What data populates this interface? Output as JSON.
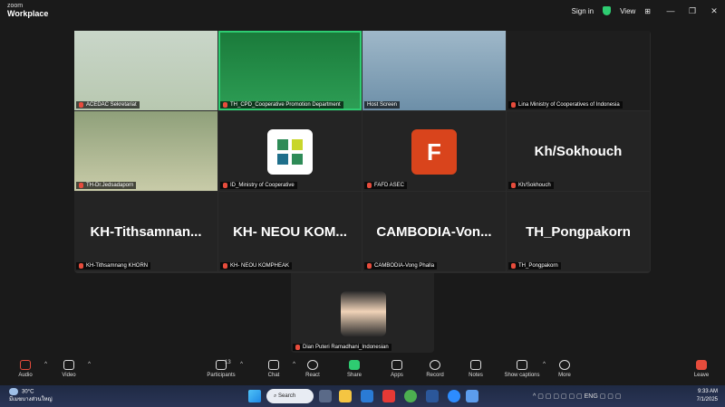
{
  "app": {
    "brand_line1": "zoom",
    "brand_line2": "Workplace"
  },
  "titlebar": {
    "sign_in": "Sign in",
    "view": "View"
  },
  "tiles": [
    {
      "name": "ACEDAC Sekretariat"
    },
    {
      "name": "TH_CPD_Cooperative Promotion Department"
    },
    {
      "name": "Host Screen"
    },
    {
      "name": "Lina Ministry of Cooperatives of Indonesia"
    },
    {
      "name": "TH-Dr.Jedsadaporn"
    },
    {
      "name": "ID_Ministry of Cooperative"
    },
    {
      "name": "FAFD ASEC",
      "icon_letter": "F"
    },
    {
      "name": "Kh/Sokhouch",
      "display": "Kh/Sokhouch"
    },
    {
      "name": "KH-Tithsamnang KHORN",
      "display": "KH-Tithsamnan..."
    },
    {
      "name": "KH- NEOU KOMPHEAK",
      "display": "KH- NEOU KOM..."
    },
    {
      "name": "CAMBODIA-Vong Phalla",
      "display": "CAMBODIA-Von..."
    },
    {
      "name": "TH_Pongpakorn",
      "display": "TH_Pongpakorn"
    }
  ],
  "solo_tile": {
    "name": "Dian Puteri Ramadhani_Indonesian"
  },
  "toolbar": {
    "audio": "Audio",
    "video": "Video",
    "participants": "Participants",
    "participants_count": "13",
    "chat": "Chat",
    "react": "React",
    "share": "Share",
    "apps": "Apps",
    "record": "Record",
    "notes": "Notes",
    "captions": "Show captions",
    "more": "More",
    "leave": "Leave"
  },
  "taskbar": {
    "temp": "30°C",
    "weather": "มีเมฆบางส่วนใหญ่",
    "search": "Search",
    "lang": "ENG",
    "time": "9:33 AM",
    "date": "7/1/2025"
  },
  "colors": {
    "accent_green": "#2ecc71",
    "leave_red": "#e74c3c",
    "fafd_orange": "#d9441c"
  }
}
